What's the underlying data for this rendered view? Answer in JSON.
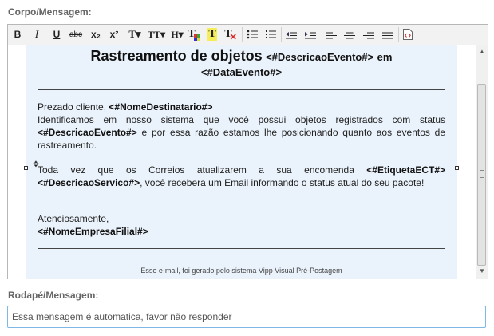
{
  "labels": {
    "corpo": "Corpo/Mensagem:",
    "rodape": "Rodapé/Mensagem:"
  },
  "toolbar": {
    "bold": "B",
    "italic": "I",
    "underline": "U",
    "strikethrough": "abc",
    "subscript": "x₂",
    "superscript": "x²",
    "font_family": "T▾",
    "font_size": "TT▾",
    "heading": "H▾",
    "font_color": "T",
    "highlight": "T",
    "clear_format": "T"
  },
  "email": {
    "title": "Rastreamento de objetos",
    "title_var1": "<#DescricaoEvento#>",
    "title_joiner": "em",
    "title_var2": "<#DataEvento#>",
    "greeting": "Prezado cliente,",
    "greeting_var": "<#NomeDestinatario#>",
    "p1_start": "Identificamos em nosso sistema que você possui objetos registrados com status",
    "p1_var": "<#DescricaoEvento#>",
    "p1_end": "e por essa razão estamos lhe posicionando quanto aos eventos de rastreamento.",
    "p2_start": "Toda vez que os Correios atualizarem a sua encomenda",
    "p2_var1": "<#EtiquetaECT#>",
    "p2_var2": "<#DescricaoServico#>",
    "p2_end": ", você recebera um Email informando o status atual do seu pacote!",
    "closing": "Atenciosamente,",
    "closing_var": "<#NomeEmpresaFilial#>",
    "footer_note": "Esse e-mail, foi gerado pelo sistema Vipp Visual Pré-Postagem"
  },
  "rodape_input": {
    "value": "Essa mensagem é automatica, favor não responder"
  },
  "colors": {
    "mail_background": "#eaf2fb",
    "input_focus_border": "#7db8e6"
  },
  "icons": [
    "bold-icon",
    "italic-icon",
    "underline-icon",
    "strikethrough-icon",
    "subscript-icon",
    "superscript-icon",
    "font-family-icon",
    "font-size-icon",
    "heading-icon",
    "font-color-icon",
    "highlight-icon",
    "clear-format-icon",
    "unordered-list-icon",
    "ordered-list-icon",
    "outdent-icon",
    "indent-icon",
    "align-left-icon",
    "align-center-icon",
    "align-right-icon",
    "justify-icon",
    "html-source-icon"
  ]
}
